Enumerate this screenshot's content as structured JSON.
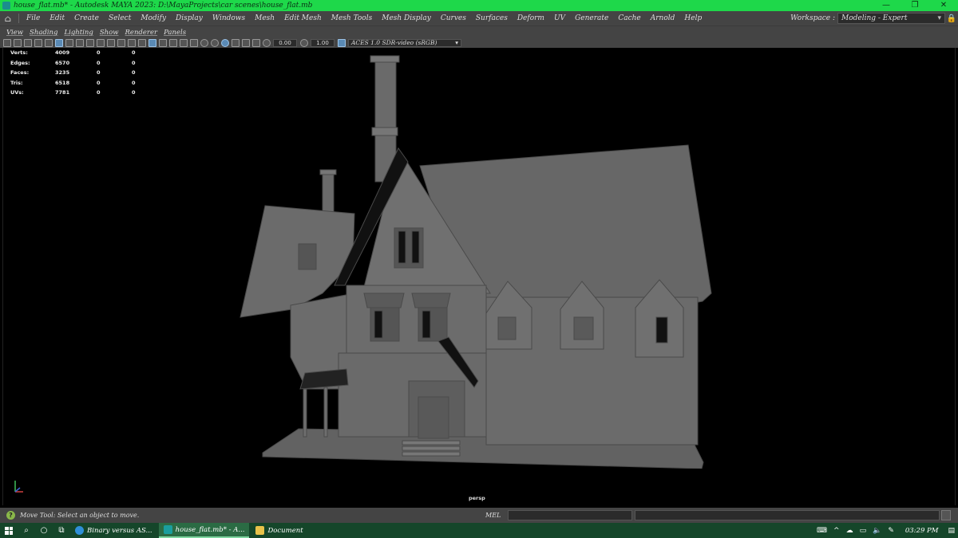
{
  "window": {
    "title": "house_flat.mb* - Autodesk MAYA 2023: D:\\MayaProjects\\car scenes\\house_flat.mb",
    "controls": [
      "—",
      "❐",
      "✕"
    ]
  },
  "menu": {
    "items": [
      "File",
      "Edit",
      "Create",
      "Select",
      "Modify",
      "Display",
      "Windows",
      "Mesh",
      "Edit Mesh",
      "Mesh Tools",
      "Mesh Display",
      "Curves",
      "Surfaces",
      "Deform",
      "UV",
      "Generate",
      "Cache",
      "Arnold",
      "Help"
    ],
    "workspace_label": "Workspace :",
    "workspace_value": "Modeling - Expert"
  },
  "panel_menu": [
    "View",
    "Shading",
    "Lighting",
    "Show",
    "Renderer",
    "Panels"
  ],
  "toolbar": {
    "exposure": "0.00",
    "gamma": "1.00",
    "color_space": "ACES 1.0 SDR-video (sRGB)"
  },
  "hud": {
    "rows": [
      {
        "label": "Verts:",
        "v": [
          "4009",
          "0",
          "0"
        ]
      },
      {
        "label": "Edges:",
        "v": [
          "6570",
          "0",
          "0"
        ]
      },
      {
        "label": "Faces:",
        "v": [
          "3235",
          "0",
          "0"
        ]
      },
      {
        "label": "Tris:",
        "v": [
          "6518",
          "0",
          "0"
        ]
      },
      {
        "label": "UVs:",
        "v": [
          "7781",
          "0",
          "0"
        ]
      }
    ]
  },
  "viewport": {
    "camera": "persp",
    "model_color": "#6e6e6e"
  },
  "status": {
    "help_text": "Move Tool: Select an object to move.",
    "command_label": "MEL"
  },
  "taskbar": {
    "tasks": [
      {
        "label": "Binary versus AS...",
        "icon_color": "#2f8fd8",
        "active": false
      },
      {
        "label": "house_flat.mb* - A...",
        "icon_color": "#1a9e9e",
        "active": true
      },
      {
        "label": "Document",
        "icon_color": "#e8c24a",
        "active": false
      }
    ],
    "clock": "03:29 PM",
    "accent": "#15462a"
  }
}
